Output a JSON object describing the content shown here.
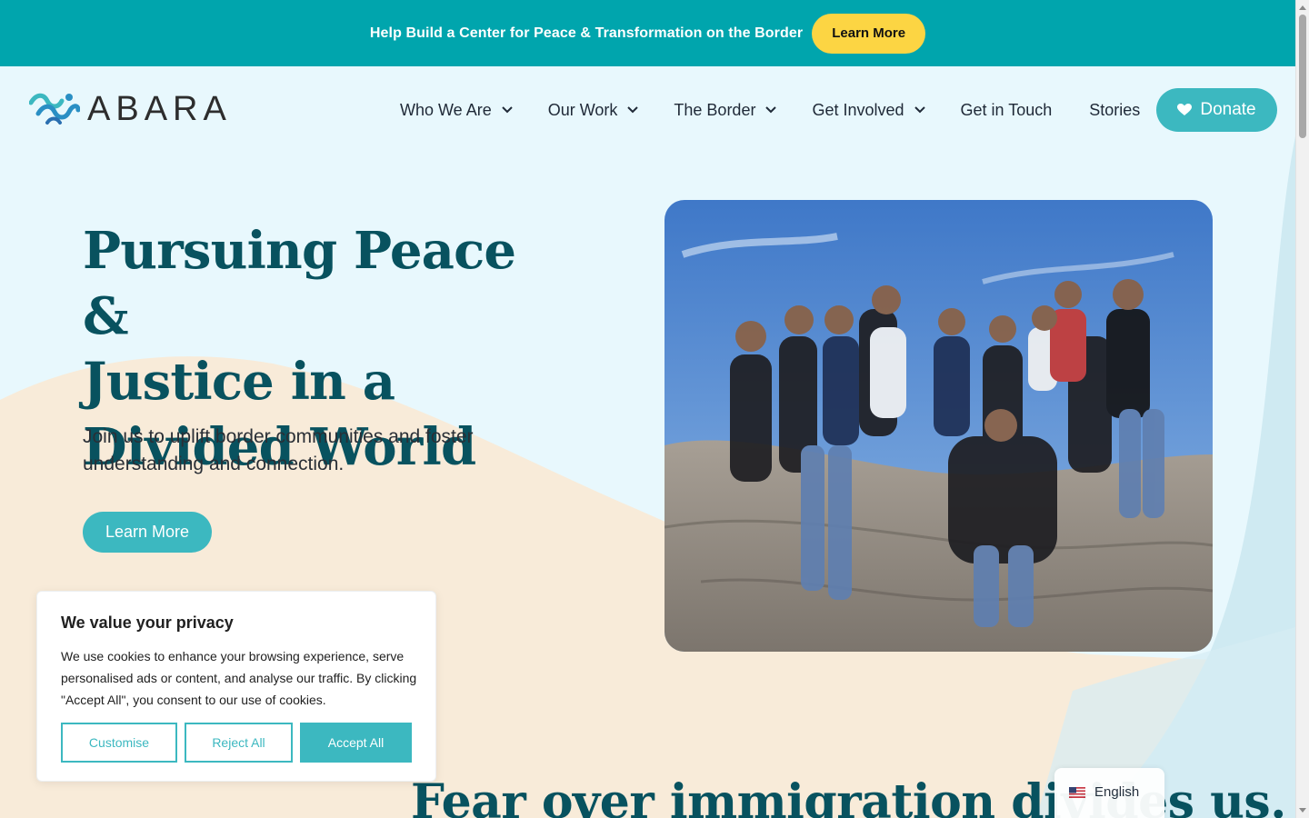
{
  "announcement": {
    "text": "Help Build a Center for Peace & Transformation on the Border",
    "button_label": "Learn More"
  },
  "header": {
    "logo_text": "ABARA",
    "nav": [
      {
        "label": "Who We Are",
        "has_dropdown": true
      },
      {
        "label": "Our Work",
        "has_dropdown": true
      },
      {
        "label": "The Border",
        "has_dropdown": true
      },
      {
        "label": "Get Involved",
        "has_dropdown": true
      },
      {
        "label": "Get in Touch",
        "has_dropdown": false
      },
      {
        "label": "Stories",
        "has_dropdown": false
      }
    ],
    "donate_label": "Donate"
  },
  "hero": {
    "title_lines": [
      "Pursuing Peace &",
      "Justice in a",
      "Divided World"
    ],
    "subtitle": "Join us to uplift border communities and foster understanding and connection.",
    "button_label": "Learn More"
  },
  "section": {
    "heading": "Fear over immigration divides us."
  },
  "cookie": {
    "title": "We value your privacy",
    "body": "We use cookies to enhance your browsing experience, serve personalised ads or content, and analyse our traffic. By clicking \"Accept All\", you consent to our use of cookies.",
    "customise_label": "Customise",
    "reject_label": "Reject All",
    "accept_label": "Accept All"
  },
  "language": {
    "label": "English",
    "flag": "us-flag-icon"
  },
  "colors": {
    "teal_bar": "#00a5ad",
    "accent_yellow": "#fcd543",
    "button_teal": "#3cb8c0",
    "heading_teal": "#08525f",
    "page_bg": "#e8f8fd",
    "wave_peach": "#f9ead8"
  }
}
